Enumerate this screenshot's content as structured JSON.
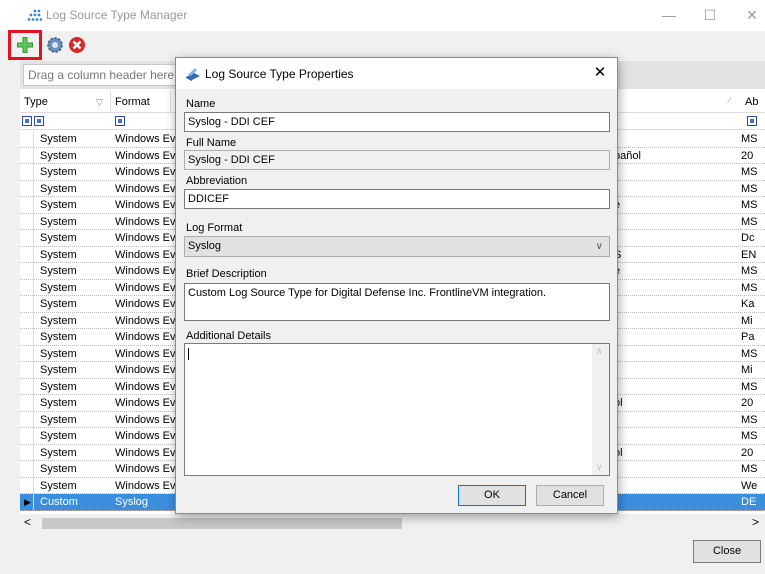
{
  "window": {
    "title": "Log Source Type Manager",
    "min": "—",
    "max": "☐",
    "close": "✕"
  },
  "toolbar": {
    "add_icon": "add-icon",
    "properties_icon": "gear-icon",
    "delete_icon": "delete-icon"
  },
  "grid": {
    "group_hint": "Drag a column header here to group by that column",
    "columns": [
      {
        "label": "Type"
      },
      {
        "label": "Format"
      },
      {
        "label": "Ab"
      }
    ],
    "rows": [
      {
        "type": "System",
        "format": "Windows Ev",
        "mid": "",
        "abbr": "MS"
      },
      {
        "type": "System",
        "format": "Windows Ev",
        "mid": "pañol",
        "abbr": "20"
      },
      {
        "type": "System",
        "format": "Windows Ev",
        "mid": "",
        "abbr": "MS"
      },
      {
        "type": "System",
        "format": "Windows Ev",
        "mid": "",
        "abbr": "MS"
      },
      {
        "type": "System",
        "format": "Windows Ev",
        "mid": "e",
        "abbr": "MS"
      },
      {
        "type": "System",
        "format": "Windows Ev",
        "mid": "",
        "abbr": "MS"
      },
      {
        "type": "System",
        "format": "Windows Ev",
        "mid": "",
        "abbr": "Dc"
      },
      {
        "type": "System",
        "format": "Windows Ev",
        "mid": "S",
        "abbr": "EN"
      },
      {
        "type": "System",
        "format": "Windows Ev",
        "mid": "e",
        "abbr": "MS"
      },
      {
        "type": "System",
        "format": "Windows Ev",
        "mid": "",
        "abbr": "MS"
      },
      {
        "type": "System",
        "format": "Windows Ev",
        "mid": "",
        "abbr": "Ka"
      },
      {
        "type": "System",
        "format": "Windows Ev",
        "mid": "",
        "abbr": "Mi"
      },
      {
        "type": "System",
        "format": "Windows Ev",
        "mid": "",
        "abbr": "Pa"
      },
      {
        "type": "System",
        "format": "Windows Ev",
        "mid": "",
        "abbr": "MS"
      },
      {
        "type": "System",
        "format": "Windows Ev",
        "mid": "",
        "abbr": "Mi"
      },
      {
        "type": "System",
        "format": "Windows Ev",
        "mid": "",
        "abbr": "MS"
      },
      {
        "type": "System",
        "format": "Windows Ev",
        "mid": "ol",
        "abbr": "20"
      },
      {
        "type": "System",
        "format": "Windows Ev",
        "mid": "",
        "abbr": "MS"
      },
      {
        "type": "System",
        "format": "Windows Ev",
        "mid": "",
        "abbr": "MS"
      },
      {
        "type": "System",
        "format": "Windows Ev",
        "mid": "ol",
        "abbr": "20"
      },
      {
        "type": "System",
        "format": "Windows Ev",
        "mid": "",
        "abbr": "MS"
      },
      {
        "type": "System",
        "format": "Windows Ev",
        "mid": "",
        "abbr": "We"
      },
      {
        "type": "Custom",
        "format": "Syslog",
        "mid": "",
        "abbr": "DE",
        "selected": true
      }
    ]
  },
  "scroll": {
    "left": "<",
    "right": ">"
  },
  "footer": {
    "close_label": "Close"
  },
  "dialog": {
    "title": "Log Source Type Properties",
    "close": "✕",
    "name_label": "Name",
    "name_value": "Syslog - DDI CEF",
    "fullname_label": "Full Name",
    "fullname_value": "Syslog - DDI CEF",
    "abbr_label": "Abbreviation",
    "abbr_value": "DDICEF",
    "format_label": "Log Format",
    "format_value": "Syslog",
    "desc_label": "Brief Description",
    "desc_value": "Custom Log Source Type for Digital Defense Inc. FrontlineVM integration.",
    "details_label": "Additional Details",
    "details_value": "",
    "ok_label": "OK",
    "cancel_label": "Cancel"
  },
  "colors": {
    "accent": "#3b8ede",
    "highlight": "#e0141e"
  }
}
